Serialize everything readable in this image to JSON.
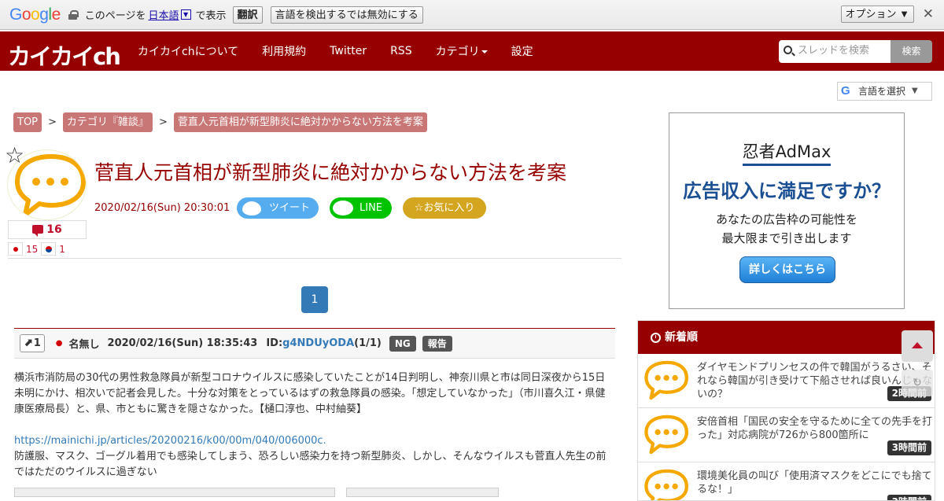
{
  "gtranslate": {
    "logo": "Google",
    "text1": "このページを",
    "lang": "日本語",
    "lang_dd": "▼",
    "text2": "で表示",
    "translate_btn": "翻訳",
    "disable_btn": "言語を検出するでは無効にする",
    "options_btn": "オプション ▼",
    "close": "✕"
  },
  "header": {
    "logo": "カイカイch",
    "nav": [
      "カイカイchについて",
      "利用規約",
      "Twitter",
      "RSS",
      "カテゴリ",
      "設定"
    ],
    "search_placeholder": "スレッドを検索",
    "search_btn": "検索"
  },
  "lang_select": {
    "label": "言語を選択",
    "arrow": "▼"
  },
  "breadcrumb": [
    "TOP",
    "カテゴリ『雑談』",
    "菅直人元首相が新型肺炎に絶対かからない方法を考案"
  ],
  "breadcrumb_sep": ">",
  "thread": {
    "title": "菅直人元首相が新型肺炎に絶対かからない方法を考案",
    "date": "2020/02/16(Sun) 20:30:01",
    "res_count": "16",
    "flag_jp_count": "15",
    "flag_kr_count": "1",
    "tweet": "ツイート",
    "line": "LINE",
    "favorite": "☆お気に入り",
    "star": "☆"
  },
  "pager": {
    "current": "1"
  },
  "post": {
    "no": "1",
    "arrow": "⬈",
    "dot": "●",
    "name": "名無し",
    "date": "2020/02/16(Sun) 18:35:43",
    "id_label": "ID:",
    "id_value": "g4NDUyODA",
    "id_count": "(1/1)",
    "ng": "NG",
    "report": "報告",
    "body1": "横浜市消防局の30代の男性救急隊員が新型コロナウイルスに感染していたことが14日判明し、神奈川県と市は同日深夜から15日未明にかけ、相次いで記者会見した。十分な対策をとっているはずの救急隊員の感染。「想定していなかった」（市川喜久江・県健康医療局長）と、県、市ともに驚きを隠さなかった。【樋口淳也、中村紬葵】",
    "link": "https://mainichi.jp/articles/20200216/k00/00m/040/006000c.",
    "body2": "防護服、マスク、ゴーグル着用でも感染してしまう、恐ろしい感染力を持つ新型肺炎、しかし、そんなウイルスも菅直人先生の前ではただのウイルスに過ぎない"
  },
  "ad": {
    "logo": "忍者AdMax",
    "headline": "広告収入に満足ですか？",
    "sub1": "あなたの広告枠の可能性を",
    "sub2": "最大限まで引き出します",
    "button": "詳しくはこちら"
  },
  "new_list": {
    "title": "新着順",
    "items": [
      {
        "text": "ダイヤモンドプリンセスの件で韓国がうるさい、それなら韓国が引き受けて下船させれば良いんじゃないの？",
        "time": "2時間前"
      },
      {
        "text": "安倍首相「国民の安全を守るために全ての先手を打った」対応病院が726から800箇所に",
        "time": "3時間前"
      },
      {
        "text": "環境美化員の叫び「使用済マスクをどこにでも捨てるな！」",
        "time": "3時間前"
      }
    ]
  },
  "colors": {
    "brand": "#960000",
    "accent_blue": "#337ab7",
    "twitter": "#55acee",
    "line": "#00c300",
    "fav": "#d4a620"
  },
  "icons": [
    "lock-icon",
    "search-icon",
    "star-icon",
    "comment-icon",
    "clock-icon",
    "chat-bubble-icon",
    "arrow-up-icon"
  ]
}
